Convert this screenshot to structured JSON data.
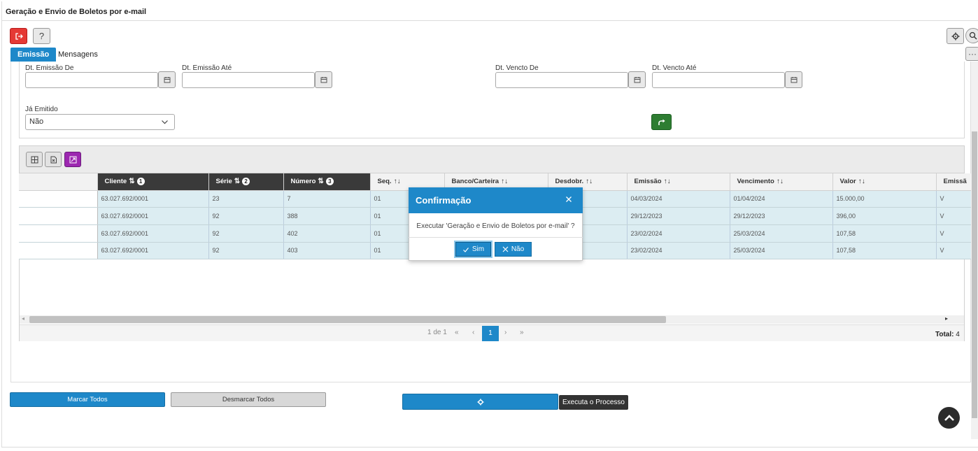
{
  "page": {
    "title": "Geração e Envio de Boletos por e-mail"
  },
  "toolbar": {
    "help_label": "?",
    "more_label": "···"
  },
  "tabs": [
    {
      "label": "Emissão",
      "active": true
    },
    {
      "label": "Mensagens",
      "active": false
    }
  ],
  "filters": {
    "dt_emissao_de": {
      "label": "Dt. Emissão De",
      "value": ""
    },
    "dt_emissao_ate": {
      "label": "Dt. Emissão Até",
      "value": ""
    },
    "dt_vencto_de": {
      "label": "Dt. Vencto De",
      "value": ""
    },
    "dt_vencto_ate": {
      "label": "Dt. Vencto Até",
      "value": ""
    },
    "ja_emitido": {
      "label": "Já Emitido",
      "value": "Não"
    }
  },
  "grid": {
    "columns": [
      {
        "label": "",
        "dark": false
      },
      {
        "label": "Cliente",
        "dark": true,
        "sort_order": "1"
      },
      {
        "label": "Série",
        "dark": true,
        "sort_order": "2"
      },
      {
        "label": "Número",
        "dark": true,
        "sort_order": "3"
      },
      {
        "label": "Seq.",
        "dark": false
      },
      {
        "label": "Banco/Carteira",
        "dark": false
      },
      {
        "label": "Desdobr.",
        "dark": false
      },
      {
        "label": "Emissão",
        "dark": false
      },
      {
        "label": "Vencimento",
        "dark": false
      },
      {
        "label": "Valor",
        "dark": false
      },
      {
        "label": "Emissã",
        "dark": false
      }
    ],
    "rows": [
      [
        "",
        "63.027.692/0001",
        "23",
        "7",
        "01",
        "",
        "",
        "04/03/2024",
        "01/04/2024",
        "15.000,00",
        "V"
      ],
      [
        "",
        "63.027.692/0001",
        "92",
        "388",
        "01",
        "",
        "",
        "29/12/2023",
        "29/12/2023",
        "396,00",
        "V"
      ],
      [
        "",
        "63.027.692/0001",
        "92",
        "402",
        "01",
        "",
        "",
        "23/02/2024",
        "25/03/2024",
        "107,58",
        "V"
      ],
      [
        "",
        "63.027.692/0001",
        "92",
        "403",
        "01",
        "",
        "",
        "23/02/2024",
        "25/03/2024",
        "107,58",
        "V"
      ]
    ],
    "pager": {
      "info": "1 de 1",
      "current_page": "1",
      "first": "«",
      "prev": "‹",
      "next": "›",
      "last": "»"
    },
    "total_label": "Total:",
    "total_value": "4"
  },
  "actions": {
    "marcar_todos": "Marcar Todos",
    "desmarcar_todos": "Desmarcar Todos",
    "executa_tooltip": "Executa o Processo"
  },
  "dialog": {
    "title": "Confirmação",
    "message": "Executar 'Geração e Envio de Boletos por e-mail' ?",
    "yes_label": "Sim",
    "no_label": "Não"
  },
  "colors": {
    "accent": "#1e88c9",
    "exit_button": "#e53935",
    "go_button": "#2e7d32",
    "export_button": "#9c27b0",
    "row_bg": "#dcedf2",
    "header_dark": "#3a3a3a"
  }
}
